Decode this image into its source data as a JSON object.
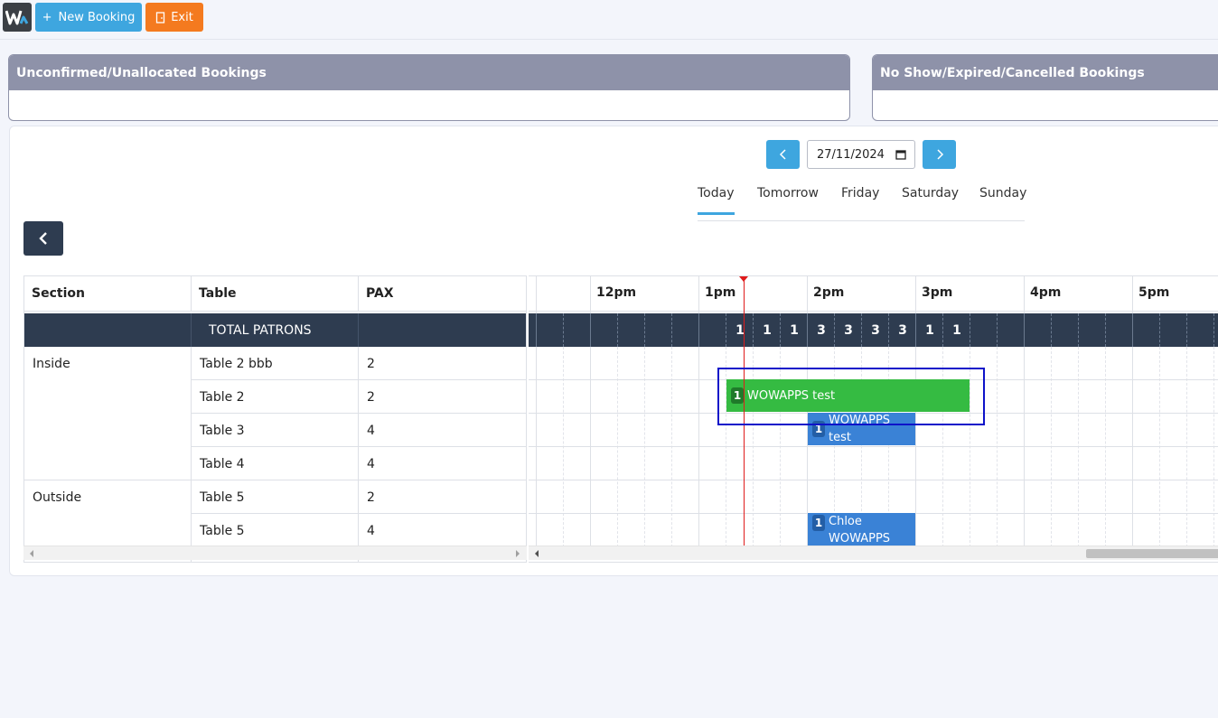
{
  "toolbar": {
    "logo_icon": "wowapps-logo-icon",
    "new_booking_label": "New Booking",
    "new_booking_icon": "plus-icon",
    "exit_label": "Exit",
    "exit_icon": "door-exit-icon"
  },
  "panels": {
    "unconfirmed_title": "Unconfirmed/Unallocated Bookings",
    "cancelled_title": "No Show/Expired/Cancelled Bookings"
  },
  "date_nav": {
    "prev_icon": "chevron-left-icon",
    "date_value": "27/11/2024",
    "calendar_icon": "calendar-icon",
    "next_icon": "chevron-right-icon"
  },
  "day_tabs": [
    "Today",
    "Tomorrow",
    "Friday",
    "Saturday",
    "Sunday"
  ],
  "active_day_tab": "Today",
  "grid": {
    "headers": {
      "section": "Section",
      "table": "Table",
      "pax": "PAX"
    },
    "total_label": "TOTAL PATRONS",
    "rows": [
      {
        "section": "Inside",
        "table": "Table 2 bbb",
        "pax": "2"
      },
      {
        "section": "",
        "table": "Table 2",
        "pax": "2"
      },
      {
        "section": "",
        "table": "Table 3",
        "pax": "4"
      },
      {
        "section": "",
        "table": "Table 4",
        "pax": "4"
      },
      {
        "section": "Outside",
        "table": "Table 5",
        "pax": "2"
      },
      {
        "section": "",
        "table": "Table 5",
        "pax": "4"
      }
    ]
  },
  "timeline": {
    "hours": [
      "12pm",
      "1pm",
      "2pm",
      "3pm",
      "4pm",
      "5pm"
    ],
    "patron_counts": [
      "1",
      "1",
      "1",
      "3",
      "3",
      "3",
      "3",
      "1",
      "1"
    ],
    "bookings": [
      {
        "pax": "1",
        "name": "WOWAPPS test",
        "table": "Table 2",
        "color": "#35bb42"
      },
      {
        "pax": "1",
        "name": "WOWAPPS test",
        "table": "Table 3",
        "color": "#3a82d6"
      },
      {
        "pax": "1",
        "name": "Chloe WOWAPPS",
        "table": "Table 5",
        "color": "#3a82d6"
      }
    ]
  },
  "colors": {
    "primary": "#3ea6df",
    "exit": "#f47a1f",
    "header_dark": "#2e3c50",
    "panel_header": "#8e92a9",
    "now_line": "#e01b1b",
    "highlight": "#0e13c9"
  }
}
